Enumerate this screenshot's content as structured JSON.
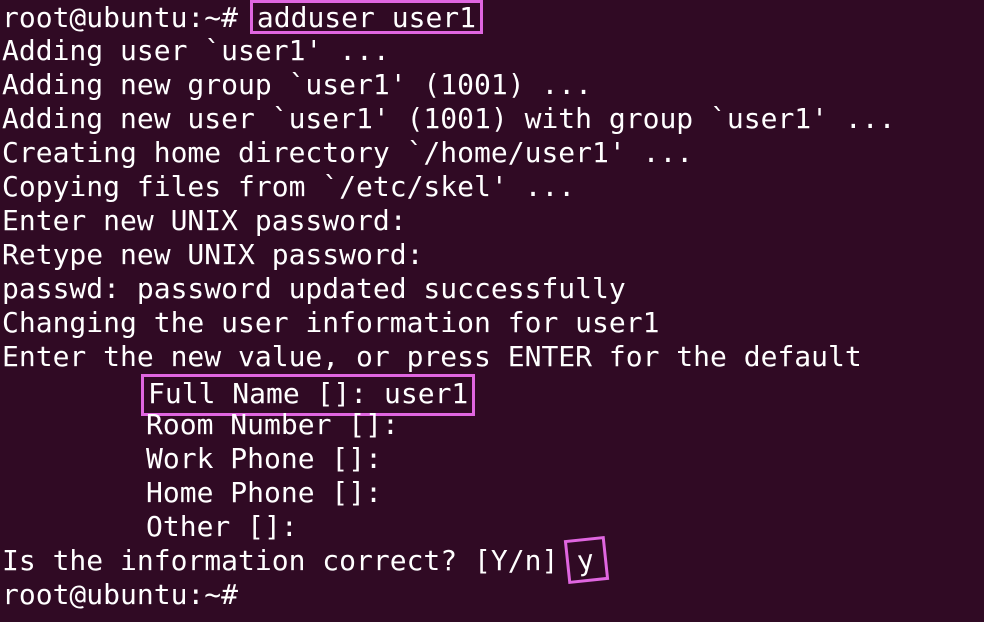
{
  "terminal": {
    "prompt": "root@ubuntu:~# ",
    "command": "adduser user1",
    "lines": {
      "l1": "Adding user `user1' ...",
      "l2": "Adding new group `user1' (1001) ...",
      "l3": "Adding new user `user1' (1001) with group `user1' ...",
      "l4": "Creating home directory `/home/user1' ...",
      "l5": "Copying files from `/etc/skel' ...",
      "l6": "Enter new UNIX password:",
      "l7": "Retype new UNIX password:",
      "l8": "passwd: password updated successfully",
      "l9": "Changing the user information for user1",
      "l10": "Enter the new value, or press ENTER for the default",
      "full_name": "Full Name []: user1",
      "room_number": "Room Number []:",
      "work_phone": "Work Phone []:",
      "home_phone": "Home Phone []:",
      "other": "Other []:",
      "confirm_question": "Is the information correct? [Y/n]",
      "confirm_answer": "y",
      "final_prompt": "root@ubuntu:~#"
    },
    "colors": {
      "background": "#300a24",
      "text": "#ffffff",
      "highlight": "#e066e0"
    }
  }
}
